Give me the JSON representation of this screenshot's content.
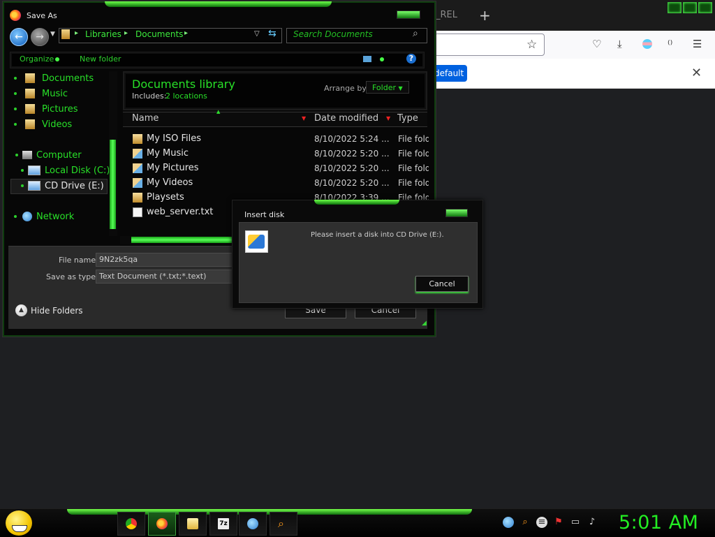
{
  "browser": {
    "tab_fragment": "_REL",
    "new_tab": "+",
    "notification_button": "default",
    "notification_close": "✕"
  },
  "save_dialog": {
    "title": "Save As",
    "breadcrumb": [
      "Libraries",
      "Documents"
    ],
    "search_placeholder": "Search Documents",
    "organize_label": "Organize",
    "new_folder_label": "New folder",
    "help_glyph": "?",
    "nav_items": [
      {
        "label": "Documents",
        "icon": "folder-icon"
      },
      {
        "label": "Music",
        "icon": "folder-icon"
      },
      {
        "label": "Pictures",
        "icon": "folder-icon"
      },
      {
        "label": "Videos",
        "icon": "folder-icon"
      },
      {
        "label": "Computer",
        "icon": "computer-icon"
      },
      {
        "label": "Local Disk (C:)",
        "icon": "drive-icon"
      },
      {
        "label": "CD Drive (E:)",
        "icon": "cd-drive-icon"
      },
      {
        "label": "Network",
        "icon": "network-icon"
      }
    ],
    "library_title": "Documents library",
    "library_includes": "Includes:",
    "library_locations": "2 locations",
    "arrange_by_label": "Arrange by:",
    "arrange_by_value": "Folder",
    "columns": {
      "name": "Name",
      "date": "Date modified",
      "type": "Type"
    },
    "files": [
      {
        "name": "My ISO Files",
        "date": "8/10/2022 5:24 ...",
        "type": "File folder",
        "icon": "folder"
      },
      {
        "name": "My Music",
        "date": "8/10/2022 5:20 ...",
        "type": "File folder",
        "icon": "special"
      },
      {
        "name": "My Pictures",
        "date": "8/10/2022 5:20 ...",
        "type": "File folder",
        "icon": "special"
      },
      {
        "name": "My Videos",
        "date": "8/10/2022 5:20 ...",
        "type": "File folder",
        "icon": "special"
      },
      {
        "name": "Playsets",
        "date": "8/10/2022 3:39 ...",
        "type": "File folder",
        "icon": "folder"
      },
      {
        "name": "web_server.txt",
        "date": "",
        "type": "",
        "icon": "txt"
      }
    ],
    "file_name_label": "File name:",
    "file_name_value": "9N2zk5qa",
    "save_type_label": "Save as type:",
    "save_type_value": "Text Document (*.txt;*.text)",
    "hide_folders_label": "Hide Folders",
    "save_button": "Save",
    "cancel_button": "Cancel"
  },
  "insert_disk": {
    "title": "Insert disk",
    "message": "Please insert a disk into CD Drive (E:).",
    "cancel_button": "Cancel"
  },
  "taskbar": {
    "clock": "5:01 AM",
    "pinned": [
      "chrome-icon",
      "firefox-icon",
      "file-explorer-icon",
      "7zip-icon",
      "network-globe-icon",
      "search-icon"
    ],
    "tray": [
      "network-icon",
      "search-icon",
      "chat-icon",
      "action-center-icon",
      "display-icon",
      "volume-icon"
    ]
  },
  "colors": {
    "accent_green": "#28e028",
    "glow_green": "#6dff4a",
    "notification_blue": "#0061e0"
  }
}
